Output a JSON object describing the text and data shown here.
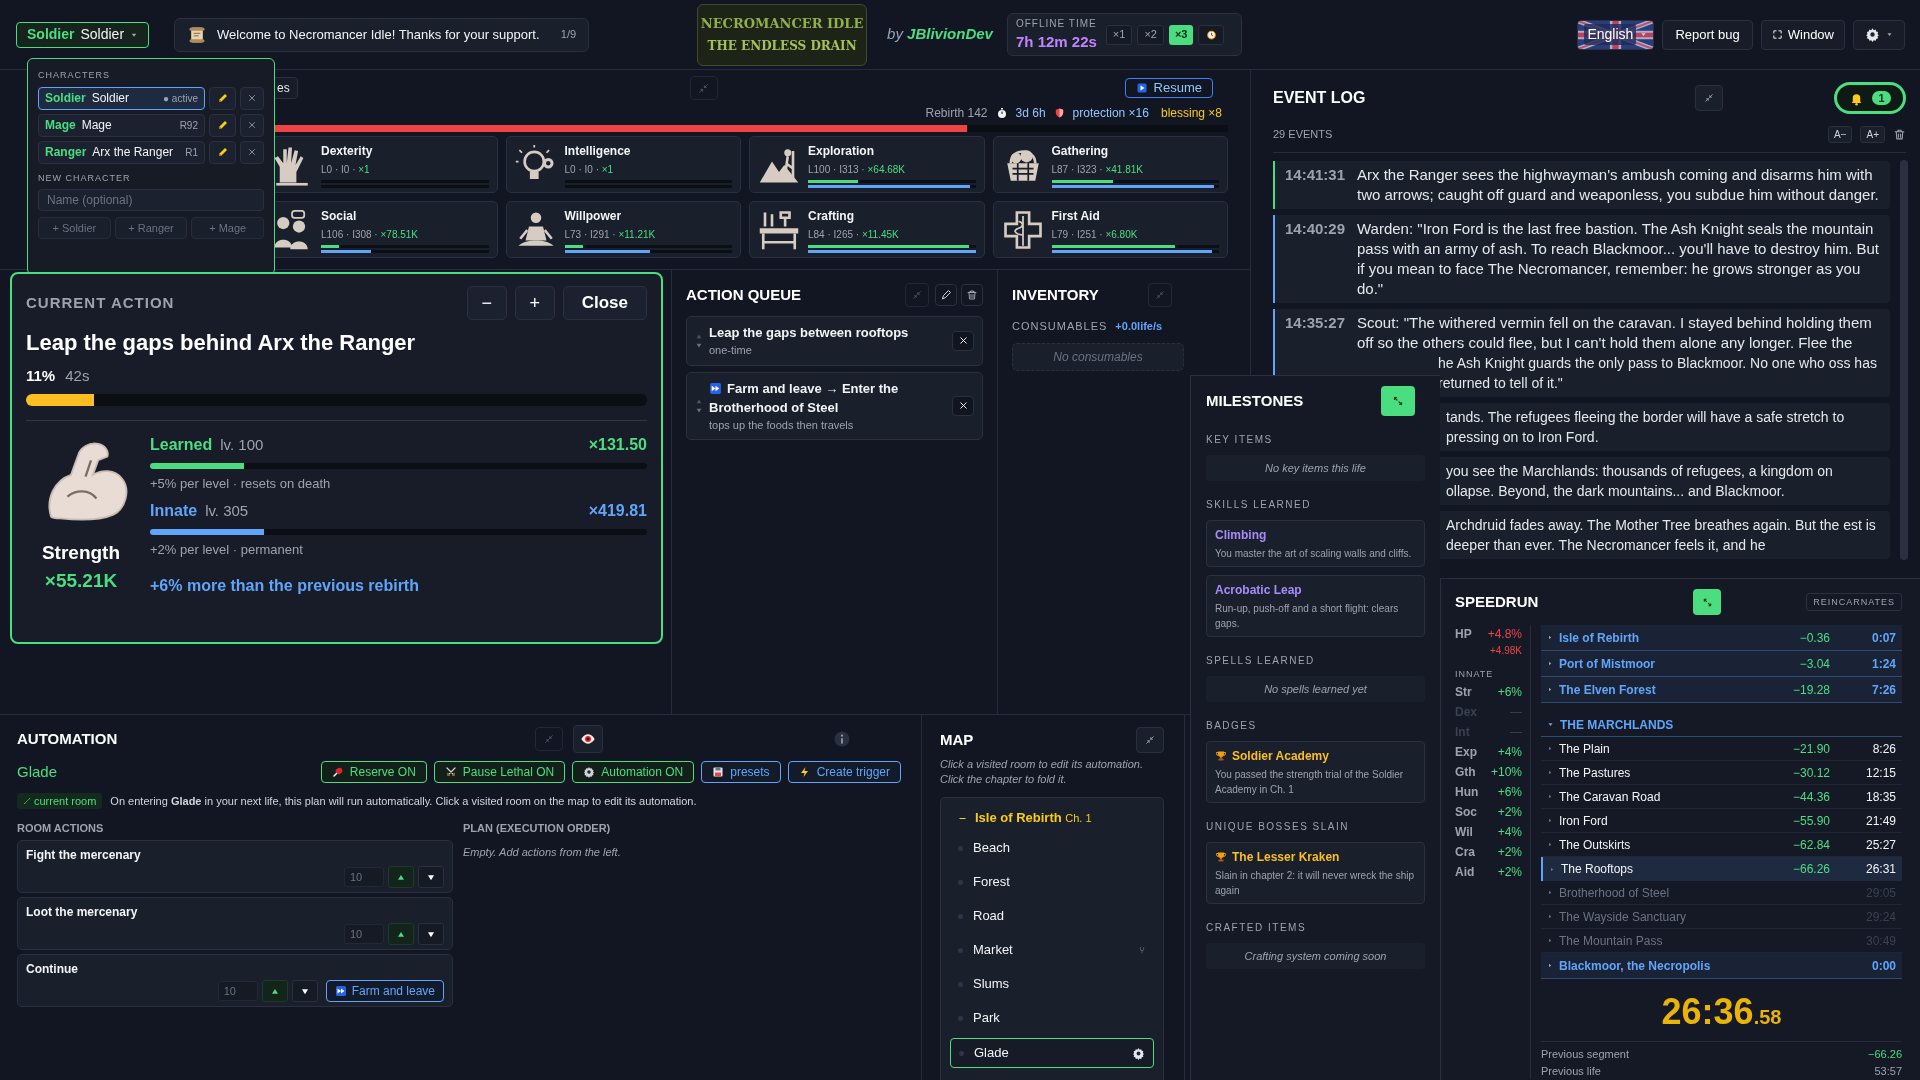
{
  "top_bar": {
    "character_selector": {
      "class": "Soldier",
      "name": "Soldier"
    },
    "notice": {
      "text": "Welcome to Necromancer Idle! Thanks for your support.",
      "counter": "1/9"
    },
    "logo": {
      "line1": "NECROMANCER IDLE",
      "line2": "THE ENDLESS DRAIN"
    },
    "byline": {
      "prefix": "by",
      "author": "JBlivionDev"
    },
    "offline": {
      "label": "OFFLINE TIME",
      "time": "7h 12m 22s",
      "speeds": [
        {
          "label": "×1",
          "selected": false
        },
        {
          "label": "×2",
          "selected": false
        },
        {
          "label": "×3",
          "selected": true
        }
      ]
    },
    "language": "English",
    "report": "Report bug",
    "window": "Window"
  },
  "characters_popup": {
    "heading": "CHARACTERS",
    "characters": [
      {
        "class": "Soldier",
        "name": "Soldier",
        "tag": "● active",
        "selected": true
      },
      {
        "class": "Mage",
        "name": "Mage",
        "tag": "R92",
        "selected": false
      },
      {
        "class": "Ranger",
        "name": "Arx the Ranger",
        "tag": "R1",
        "selected": false
      }
    ],
    "new_heading": "NEW CHARACTER",
    "name_placeholder": "Name (optional)",
    "add_buttons": [
      "+ Soldier",
      "+ Ranger",
      "+ Mage"
    ]
  },
  "skills_panel": {
    "tab_fragment": "es",
    "resume": "Resume",
    "rebirth": "Rebirth 142",
    "time": "3d 6h",
    "protection": "protection ×16",
    "blessing": "blessing ×8",
    "rebirth_bar": {
      "level": 0.73
    },
    "skills": [
      {
        "name": "Dexterity",
        "levels": "L0 · I0 ·",
        "mult": "×1",
        "learned_bar": {
          "level": 0
        },
        "innate_bar": {
          "level": 0
        }
      },
      {
        "name": "Intelligence",
        "levels": "L0 · I0 ·",
        "mult": "×1",
        "learned_bar": {
          "level": 0
        },
        "innate_bar": {
          "level": 0
        }
      },
      {
        "name": "Exploration",
        "levels": "L100 · I313 ·",
        "mult": "×64.68K",
        "learned_bar": {
          "level": 0.3
        },
        "innate_bar": {
          "level": 0.97
        }
      },
      {
        "name": "Gathering",
        "levels": "L87 · I323 ·",
        "mult": "×41.81K",
        "learned_bar": {
          "level": 0.37
        },
        "innate_bar": {
          "level": 0.97
        }
      },
      {
        "name": "Social",
        "levels": "L106 · I308 ·",
        "mult": "×78.51K",
        "learned_bar": {
          "level": 0.11
        },
        "innate_bar": {
          "level": 0.3
        }
      },
      {
        "name": "Willpower",
        "levels": "L73 · I291 ·",
        "mult": "×11.21K",
        "learned_bar": {
          "level": 0.11
        },
        "innate_bar": {
          "level": 0.51
        }
      },
      {
        "name": "Crafting",
        "levels": "L84 · I265 ·",
        "mult": "×11.45K",
        "learned_bar": {
          "level": 0.96
        },
        "innate_bar": {
          "level": 1
        }
      },
      {
        "name": "First Aid",
        "levels": "L79 · I251 ·",
        "mult": "×6.80K",
        "learned_bar": {
          "level": 0.74
        },
        "innate_bar": {
          "level": 0.96
        }
      }
    ]
  },
  "current_action": {
    "heading": "CURRENT ACTION",
    "minus": "−",
    "plus": "+",
    "close": "Close",
    "title": "Leap the gaps behind Arx the Ranger",
    "percent": "11%",
    "remaining": "42s",
    "progress": {
      "level": 0.11
    },
    "stat": {
      "name": "Strength",
      "mult": "×55.21K"
    },
    "tracks": [
      {
        "kind": "learned",
        "label": "Learned",
        "lv": "lv. 100",
        "mult": "×131.50",
        "bar": {
          "level": 0.19
        },
        "note": "+5% per level · resets on death"
      },
      {
        "kind": "innate",
        "label": "Innate",
        "lv": "lv. 305",
        "mult": "×419.81",
        "bar": {
          "level": 0.23
        },
        "note": "+2% per level · permanent"
      }
    ],
    "comparison": "+6% more than the previous rebirth"
  },
  "action_queue": {
    "title": "ACTION QUEUE",
    "items": [
      {
        "kind": "once",
        "title": "Leap the gaps between rooftops",
        "subtitle": "one-time"
      },
      {
        "kind": "farm",
        "title": "Farm and leave → Enter the Brotherhood of Steel",
        "subtitle": "tops up the foods then travels"
      }
    ]
  },
  "inventory": {
    "title": "INVENTORY",
    "section": "CONSUMABLES",
    "rate": "+0.0life/s",
    "empty": "No consumables"
  },
  "event_log": {
    "title": "EVENT LOG",
    "notifications": "1",
    "count": "29 EVENTS",
    "smaller": "A−",
    "larger": "A+",
    "events": [
      {
        "kind": "full",
        "time": "14:41:31",
        "color": "#4ade80",
        "text": "Arx the Ranger sees the highwayman's ambush coming and disarms him with two arrows; caught off guard and weaponless, you subdue him without danger."
      },
      {
        "kind": "full",
        "time": "14:40:29",
        "color": "#60a5fa",
        "text": "Warden: \"Iron Ford is the last free bastion. The Ash Knight seals the mountain pass with an army of ash. To reach Blackmoor... you'll have to destroy him. But if you mean to face The Necromancer, remember: he grows stronger as you do.\""
      },
      {
        "kind": "partial",
        "time": "14:35:27",
        "color": "#60a5fa",
        "text": "Scout: \"The withered vermin fell on the caravan. I stayed behind holding them off so the others could flee, but I can't hold them alone any longer. Flee the",
        "continuation": "he Ash Knight guards the only pass to Blackmoor. No one who oss has returned to tell of it.\""
      },
      {
        "kind": "fragment",
        "text": "tands. The refugees fleeing the border will have a safe stretch to pressing on to Iron Ford."
      },
      {
        "kind": "fragment",
        "text": "you see the Marchlands: thousands of refugees, a kingdom on ollapse. Beyond, the dark mountains... and Blackmoor."
      },
      {
        "kind": "fragment",
        "text": "Archdruid fades away. The Mother Tree breathes again. But the est is deeper than ever. The Necromancer feels it, and he"
      }
    ]
  },
  "automation": {
    "title": "AUTOMATION",
    "room": "Glade",
    "buttons": [
      {
        "kind": "toggle",
        "label": "Reserve ON",
        "on": true
      },
      {
        "kind": "toggle",
        "label": "Pause Lethal ON",
        "on": true
      },
      {
        "kind": "toggle",
        "label": "Automation ON",
        "on": true
      },
      {
        "kind": "action",
        "label": "presets"
      },
      {
        "kind": "action",
        "label": "Create trigger"
      }
    ],
    "room_tag": "current room",
    "info": "On entering **Glade** in your next life, this plan will run automatically. Click a visited room on the map to edit its automation.",
    "room_actions_title": "ROOM ACTIONS",
    "room_actions": [
      {
        "kind": "plain",
        "name": "Fight the mercenary",
        "count": "10"
      },
      {
        "kind": "plain",
        "name": "Loot the mercenary",
        "count": "10"
      },
      {
        "kind": "farm",
        "name": "Continue",
        "count": "10",
        "extra": "Farm and leave"
      }
    ],
    "plan_title": "PLAN (EXECUTION ORDER)",
    "plan_empty": "Empty. Add actions from the left."
  },
  "map": {
    "title": "MAP",
    "hint": "Click a visited room to edit its automation. Click the chapter to fold it.",
    "chapter": {
      "name": "Isle of Rebirth",
      "number": "Ch. 1",
      "expanded": true,
      "rooms": [
        {
          "name": "Beach",
          "kind": "plain",
          "selected": false
        },
        {
          "name": "Forest",
          "kind": "plain",
          "selected": false
        },
        {
          "name": "Road",
          "kind": "plain",
          "selected": false
        },
        {
          "name": "Market",
          "kind": "fork",
          "selected": false
        },
        {
          "name": "Slums",
          "kind": "plain",
          "selected": false
        },
        {
          "name": "Park",
          "kind": "plain",
          "selected": false
        },
        {
          "name": "Glade",
          "kind": "plain",
          "selected": true
        }
      ]
    }
  },
  "milestones": {
    "title": "MILESTONES",
    "sections": [
      {
        "title": "KEY ITEMS",
        "kind": "empty",
        "empty": "No key items this life"
      },
      {
        "title": "SKILLS LEARNED",
        "kind": "skill",
        "items": [
          {
            "name": "Climbing",
            "desc": "You master the art of scaling walls and cliffs."
          },
          {
            "name": "Acrobatic Leap",
            "desc": "Run-up, push-off and a short flight: clears gaps."
          }
        ]
      },
      {
        "title": "SPELLS LEARNED",
        "kind": "empty",
        "empty": "No spells learned yet"
      },
      {
        "title": "BADGES",
        "kind": "trophy",
        "items": [
          {
            "name": "Soldier Academy",
            "desc": "You passed the strength trial of the Soldier Academy in Ch. 1"
          }
        ]
      },
      {
        "title": "UNIQUE BOSSES SLAIN",
        "kind": "trophy",
        "items": [
          {
            "name": "The Lesser Kraken",
            "desc": "Slain in chapter 2: it will never wreck the ship again"
          }
        ]
      },
      {
        "title": "CRAFTED ITEMS",
        "kind": "empty",
        "empty": "Crafting system coming soon"
      }
    ]
  },
  "speedrun": {
    "title": "SPEEDRUN",
    "badge": "REINCARNATES",
    "hp": {
      "label": "HP",
      "pct": "+4.8%",
      "abs": "+4.98K"
    },
    "innate_label": "INNATE",
    "innate": [
      {
        "label": "Str",
        "value": "+6%",
        "active": true
      },
      {
        "label": "Dex",
        "value": "—",
        "active": false
      },
      {
        "label": "Int",
        "value": "—",
        "active": false
      },
      {
        "label": "Exp",
        "value": "+4%",
        "active": true
      },
      {
        "label": "Gth",
        "value": "+10%",
        "active": true
      },
      {
        "label": "Hun",
        "value": "+6%",
        "active": true
      },
      {
        "label": "Soc",
        "value": "+2%",
        "active": true
      },
      {
        "label": "Wil",
        "value": "+4%",
        "active": true
      },
      {
        "label": "Cra",
        "value": "+2%",
        "active": true
      },
      {
        "label": "Aid",
        "value": "+2%",
        "active": true
      }
    ],
    "chapters": [
      {
        "name": "Isle of Rebirth",
        "delta": "−0.36",
        "time": "0:07"
      },
      {
        "name": "Port of Mistmoor",
        "delta": "−3.04",
        "time": "1:24"
      },
      {
        "name": "The Elven Forest",
        "delta": "−19.28",
        "time": "7:26"
      }
    ],
    "current_chapter": {
      "name": "THE MARCHLANDS",
      "expanded": true,
      "splits": [
        {
          "kind": "done",
          "name": "The Plain",
          "delta": "−21.90",
          "time": "8:26",
          "selected": false
        },
        {
          "kind": "done",
          "name": "The Pastures",
          "delta": "−30.12",
          "time": "12:15",
          "selected": false
        },
        {
          "kind": "done",
          "name": "The Caravan Road",
          "delta": "−44.36",
          "time": "18:35",
          "selected": false
        },
        {
          "kind": "done",
          "name": "Iron Ford",
          "delta": "−55.90",
          "time": "21:49",
          "selected": false
        },
        {
          "kind": "done",
          "name": "The Outskirts",
          "delta": "−62.84",
          "time": "25:27",
          "selected": false
        },
        {
          "kind": "done",
          "name": "The Rooftops",
          "delta": "−66.26",
          "time": "26:31",
          "selected": true
        },
        {
          "kind": "upcoming",
          "name": "Brotherhood of Steel",
          "time": "29:05",
          "selected": false
        },
        {
          "kind": "upcoming",
          "name": "The Wayside Sanctuary",
          "time": "29:24",
          "selected": false
        },
        {
          "kind": "upcoming",
          "name": "The Mountain Pass",
          "time": "30:49",
          "selected": false
        }
      ]
    },
    "next_chapters": [
      {
        "name": "Blackmoor, the Necropolis",
        "time": "0:00"
      }
    ],
    "timer": "26:36",
    "timer_fraction": ".58",
    "previous_segment": {
      "label": "Previous segment",
      "value": "−66.26"
    },
    "previous_life": {
      "label": "Previous life",
      "value": "53:57"
    }
  }
}
